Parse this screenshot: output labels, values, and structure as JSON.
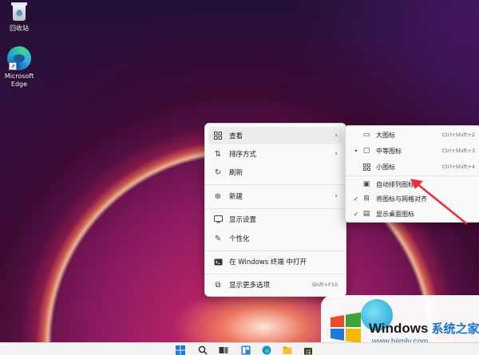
{
  "desktop": {
    "icons": [
      {
        "label": "回收站",
        "icon": "recycle-bin-icon"
      },
      {
        "label": "Microsoft Edge",
        "icon": "edge-icon"
      }
    ]
  },
  "context_menu": {
    "items": [
      {
        "label": "查看",
        "icon": "grid-icon",
        "has_submenu": true,
        "active": true
      },
      {
        "label": "排序方式",
        "icon": "sort-icon",
        "has_submenu": true
      },
      {
        "label": "刷新",
        "icon": "refresh-icon"
      },
      {
        "label": "新建",
        "icon": "new-icon",
        "has_submenu": true
      },
      {
        "label": "显示设置",
        "icon": "display-settings-icon"
      },
      {
        "label": "个性化",
        "icon": "brush-icon"
      },
      {
        "label": "在 Windows 终端 中打开",
        "icon": "terminal-icon"
      },
      {
        "label": "显示更多选项",
        "icon": "more-options-icon",
        "shortcut": "Shift+F10"
      }
    ]
  },
  "view_submenu": {
    "items": [
      {
        "label": "大图标",
        "icon": "large-icons-icon",
        "shortcut": "Ctrl+Shift+2",
        "mark": ""
      },
      {
        "label": "中等图标",
        "icon": "medium-icons-icon",
        "shortcut": "Ctrl+Shift+3",
        "mark": "•"
      },
      {
        "label": "小图标",
        "icon": "small-icons-icon",
        "shortcut": "Ctrl+Shift+4",
        "mark": ""
      },
      {
        "label": "自动排列图标",
        "icon": "auto-arrange-icon",
        "mark": ""
      },
      {
        "label": "将图标与网格对齐",
        "icon": "align-grid-icon",
        "mark": "✓"
      },
      {
        "label": "显示桌面图标",
        "icon": "show-desktop-icons-icon",
        "mark": "✓"
      }
    ]
  },
  "watermark": {
    "brand": "Windows",
    "brand_cn": "系统之家",
    "url": "www.bjjmlv.com"
  },
  "colors": {
    "arrow": "#e8303a",
    "menu_bg": "#f9f9f9",
    "link_blue": "#1a73c8"
  }
}
